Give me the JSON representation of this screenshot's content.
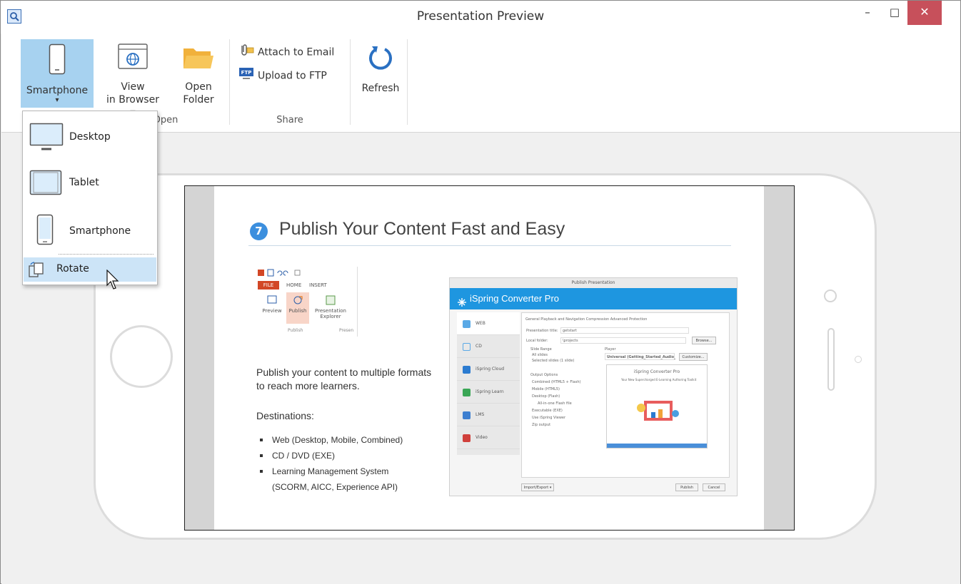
{
  "window": {
    "title": "Presentation Preview",
    "minimize": "–",
    "maximize": "□",
    "close": "✕"
  },
  "ribbon": {
    "smartphone": {
      "label": "Smartphone",
      "arrow": "▾"
    },
    "view_in_browser": {
      "line1": "View",
      "line2": "in Browser ▾"
    },
    "open_folder": {
      "line1": "Open",
      "line2": "Folder"
    },
    "open_group_label": "Open",
    "attach_to_email": "Attach to Email",
    "upload_to_ftp": "Upload to FTP",
    "share_group_label": "Share",
    "refresh": "Refresh"
  },
  "dropdown": {
    "items": [
      {
        "label": "Desktop",
        "icon": "desktop-icon"
      },
      {
        "label": "Tablet",
        "icon": "tablet-icon"
      },
      {
        "label": "Smartphone",
        "icon": "smartphone-icon"
      },
      {
        "label": "Rotate",
        "icon": "rotate-icon"
      }
    ]
  },
  "slide": {
    "number": "7",
    "title": "Publish Your Content Fast and Easy",
    "paragraph": "Publish your content to multiple formats to reach more learners.",
    "destinations_heading": "Destinations:",
    "bullets": [
      "Web (Desktop, Mobile, Combined)",
      "CD / DVD (EXE)",
      "Learning Management System",
      "(SCORM, AICC, Experience API)"
    ],
    "mini_ribbon": {
      "tabs": [
        "FILE",
        "HOME",
        "INSERT"
      ],
      "items": [
        "Preview",
        "Publish",
        "Presentation Explorer"
      ],
      "groups": [
        "Publish",
        "Presen"
      ]
    },
    "dialog": {
      "title": "Publish Presentation",
      "header": "iSpring Converter Pro",
      "nav": [
        "WEB",
        "CD",
        "iSpring Cloud",
        "iSpring Learn",
        "LMS",
        "Video"
      ],
      "tabs": "General  Playback and Navigation  Compression  Advanced  Protection",
      "presentation_title_label": "Presentation title:",
      "presentation_title_value": "getstart",
      "local_folder_label": "Local folder:",
      "local_folder_value": "\\projects",
      "browse": "Browse...",
      "slide_range": "Slide Range",
      "all_slides": "All slides",
      "selected_slides": "Selected slides (1 slide)",
      "player": "Player",
      "player_value": "Universal (Getting_Started_Audio_",
      "customize": "Customize...",
      "output_options": "Output Options",
      "outputs": [
        "Combined (HTML5 + Flash)",
        "Mobile (HTML5)",
        "Desktop (Flash)",
        "All-in-one Flash file",
        "Executable (EXE)",
        "Use iSpring Viewer",
        "Zip output"
      ],
      "preview_title": "iSpring Converter Pro",
      "preview_sub": "Your New Supercharged E-Learning Authoring Toolkit",
      "import_export": "Import/Export ▾",
      "publish": "Publish",
      "cancel": "Cancel"
    }
  },
  "colors": {
    "accent": "#a7d2f0",
    "close_button": "#c7505b",
    "dialog_header": "#1e96e0",
    "menu_highlight": "#cce4f7"
  }
}
